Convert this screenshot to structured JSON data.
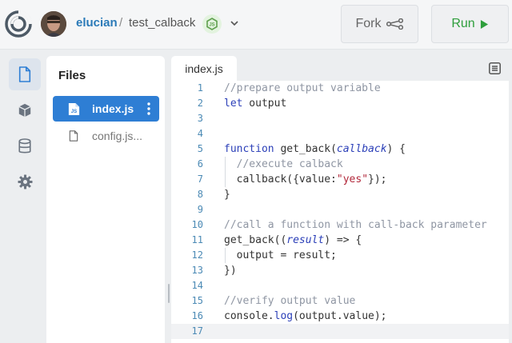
{
  "header": {
    "username": "elucian",
    "separator": "/",
    "project": "test_calback",
    "fork_label": "Fork",
    "run_label": "Run",
    "logo_icon": "replit-logo-icon",
    "language_icon": "nodejs-icon"
  },
  "rail": {
    "items": [
      {
        "name": "files",
        "icon": "file-icon",
        "active": true
      },
      {
        "name": "packages",
        "icon": "cube-icon",
        "active": false
      },
      {
        "name": "database",
        "icon": "database-icon",
        "active": false
      },
      {
        "name": "settings",
        "icon": "gear-icon",
        "active": false
      }
    ]
  },
  "files": {
    "title": "Files",
    "items": [
      {
        "badge": "JS",
        "name": "index.js",
        "active": true
      },
      {
        "badge": "",
        "name": "config.js...",
        "active": false
      }
    ]
  },
  "editor": {
    "tab_label": "index.js",
    "lines": [
      {
        "n": "1",
        "text": "//prepare output variable"
      },
      {
        "n": "2",
        "text": "let output"
      },
      {
        "n": "3",
        "text": ""
      },
      {
        "n": "4",
        "text": ""
      },
      {
        "n": "5",
        "text": "function get_back(callback) {"
      },
      {
        "n": "6",
        "text": "  //execute calback"
      },
      {
        "n": "7",
        "text": "  callback({value:\"yes\"});"
      },
      {
        "n": "8",
        "text": "}"
      },
      {
        "n": "9",
        "text": ""
      },
      {
        "n": "10",
        "text": "//call a function with call-back parameter"
      },
      {
        "n": "11",
        "text": "get_back((result) => {"
      },
      {
        "n": "12",
        "text": "  output = result;"
      },
      {
        "n": "13",
        "text": "})"
      },
      {
        "n": "14",
        "text": ""
      },
      {
        "n": "15",
        "text": "//verify output value"
      },
      {
        "n": "16",
        "text": "console.log(output.value);"
      },
      {
        "n": "17",
        "text": ""
      }
    ],
    "current_line": "17"
  },
  "colors": {
    "accent": "#2e7ed4",
    "run_green": "#2e9e3c",
    "username_blue": "#2a7ab8"
  }
}
